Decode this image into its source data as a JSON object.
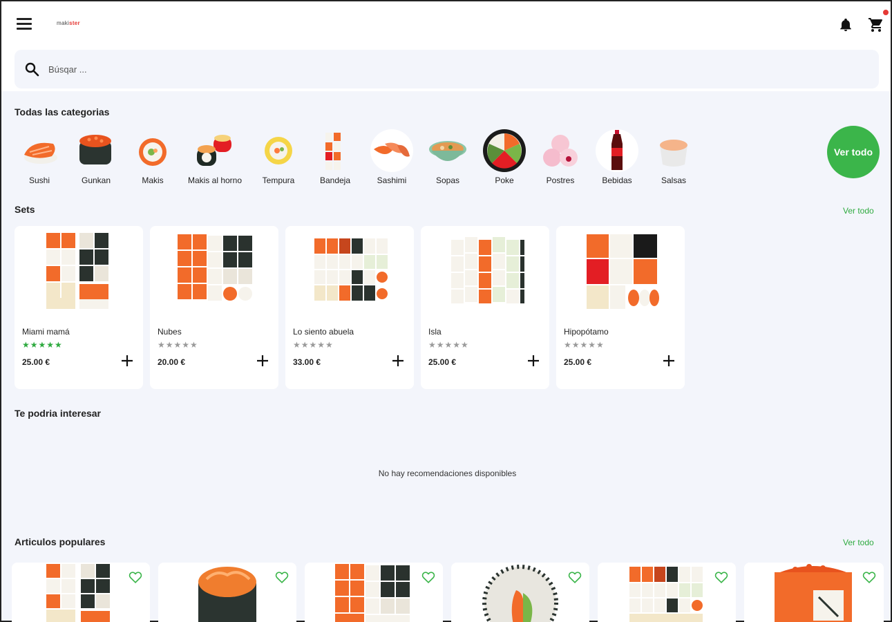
{
  "header": {
    "logo_text_a": "maki",
    "logo_text_b": "ster",
    "cart_badge_color": "#e53935"
  },
  "search": {
    "placeholder": "Búsqar ..."
  },
  "categories": {
    "title": "Todas las categorias",
    "see_all": "Ver todo",
    "items": [
      {
        "label": "Sushi",
        "icon": "sushi-nigiri-icon"
      },
      {
        "label": "Gunkan",
        "icon": "gunkan-icon"
      },
      {
        "label": "Makis",
        "icon": "maki-roll-icon"
      },
      {
        "label": "Makis al horno",
        "icon": "baked-maki-icon"
      },
      {
        "label": "Tempura",
        "icon": "tempura-roll-icon"
      },
      {
        "label": "Bandeja",
        "icon": "tray-icon"
      },
      {
        "label": "Sashimi",
        "icon": "sashimi-icon"
      },
      {
        "label": "Sopas",
        "icon": "soup-bowl-icon"
      },
      {
        "label": "Poke",
        "icon": "poke-bowl-icon"
      },
      {
        "label": "Postres",
        "icon": "mochi-dessert-icon"
      },
      {
        "label": "Bebidas",
        "icon": "cola-bottle-icon"
      },
      {
        "label": "Salsas",
        "icon": "sauce-cup-icon"
      }
    ]
  },
  "sets": {
    "title": "Sets",
    "see_all": "Ver todo",
    "items": [
      {
        "name": "Miami mamá",
        "price": "25.00 €",
        "rating": 5,
        "stars": "★★★★★"
      },
      {
        "name": "Nubes",
        "price": "20.00 €",
        "rating": 0,
        "stars": "★★★★★"
      },
      {
        "name": "Lo siento abuela",
        "price": "33.00 €",
        "rating": 0,
        "stars": "★★★★★"
      },
      {
        "name": "Isla",
        "price": "25.00 €",
        "rating": 0,
        "stars": "★★★★★"
      },
      {
        "name": "Hipopótamo",
        "price": "25.00 €",
        "rating": 0,
        "stars": "★★★★★"
      }
    ]
  },
  "recommendations": {
    "title": "Te podria interesar",
    "empty_message": "No hay recomendaciones disponibles"
  },
  "popular": {
    "title": "Articulos populares",
    "see_all": "Ver todo",
    "count": 6
  },
  "colors": {
    "accent_green": "#3bb54a",
    "star_filled": "#2eaa3f",
    "star_empty": "#9a9a9a",
    "salmon": "#f26b2a",
    "nori": "#1f2a24"
  }
}
